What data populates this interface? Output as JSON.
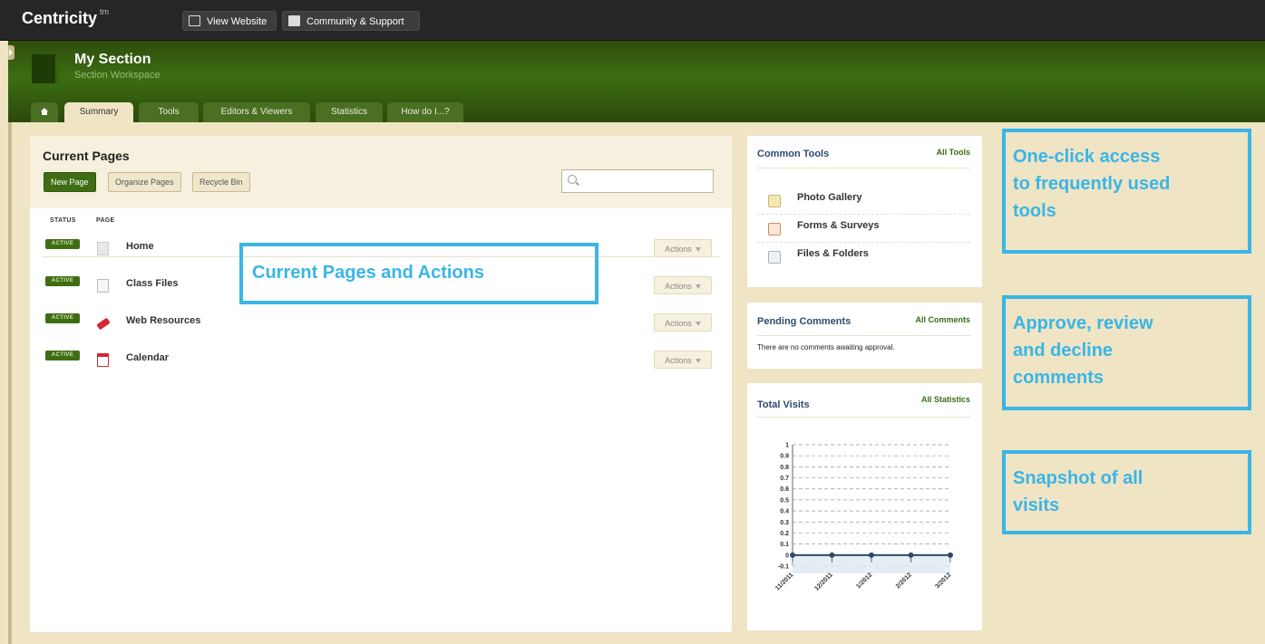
{
  "topbar": {
    "brand": "Centricity",
    "brand_sup": "tm",
    "view_website": "View Website",
    "community_support": "Community & Support"
  },
  "header": {
    "title": "My Section",
    "subtitle": "Section Workspace",
    "tabs": [
      "Summary",
      "Tools",
      "Editors & Viewers",
      "Statistics",
      "How do I...?"
    ]
  },
  "current_pages": {
    "title": "Current Pages",
    "new_page": "New Page",
    "organize_pages": "Organize Pages",
    "recycle_bin": "Recycle Bin",
    "search_placeholder": "",
    "col_status": "STATUS",
    "col_page": "PAGE",
    "rows": [
      {
        "status": "ACTIVE",
        "name": "Home",
        "actions": "Actions",
        "icon": "page-icon"
      },
      {
        "status": "ACTIVE",
        "name": "Class Files",
        "actions": "Actions",
        "icon": "files-icon"
      },
      {
        "status": "ACTIVE",
        "name": "Web Resources",
        "actions": "Actions",
        "icon": "link-icon"
      },
      {
        "status": "ACTIVE",
        "name": "Calendar",
        "actions": "Actions",
        "icon": "calendar-icon"
      }
    ]
  },
  "common_tools": {
    "title": "Common Tools",
    "link": "All Tools",
    "items": [
      "Photo Gallery",
      "Forms & Surveys",
      "Files & Folders"
    ]
  },
  "pending_comments": {
    "title": "Pending Comments",
    "link": "All Comments",
    "message": "There are no comments awaiting approval."
  },
  "total_visits": {
    "title": "Total Visits",
    "link": "All Statistics"
  },
  "chart_data": {
    "type": "line",
    "x": [
      "11/2011",
      "12/2011",
      "1/2012",
      "2/2012",
      "3/2012"
    ],
    "values": [
      0,
      0,
      0,
      0,
      0
    ],
    "ylim": [
      -0.1,
      1
    ],
    "yticks": [
      "1",
      "0.9",
      "0.8",
      "0.7",
      "0.6",
      "0.5",
      "0.4",
      "0.3",
      "0.2",
      "0.1",
      "0",
      "-0.1"
    ],
    "grid": true,
    "color": "#2d4a6d"
  },
  "callouts": {
    "pages": "Current Pages and Actions",
    "tools": [
      "One-click access",
      "to frequently used",
      "tools"
    ],
    "comments": [
      "Approve, review",
      "and decline",
      "comments"
    ],
    "visits": [
      "Snapshot of all",
      "visits"
    ]
  }
}
